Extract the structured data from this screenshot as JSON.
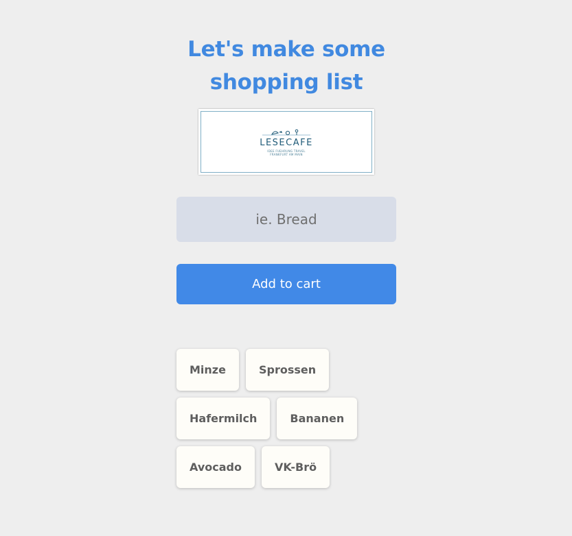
{
  "header": {
    "title_line1": "Let's make some",
    "title_line2": "shopping list"
  },
  "logo": {
    "name": "LESECAFE",
    "subtitle_line1": "IDEE FUEHRUNG TRAVEL",
    "subtitle_line2": "FRANKFURT AM MAIN"
  },
  "form": {
    "input_placeholder": "ie. Bread",
    "input_value": "",
    "add_button_label": "Add to cart"
  },
  "shopping_list": {
    "rows": [
      [
        "Minze",
        "Sprossen"
      ],
      [
        "Hafermilch",
        "Bananen"
      ],
      [
        "Avocado",
        "VK-Brö"
      ]
    ]
  },
  "colors": {
    "accent": "#4189e7",
    "title": "#4189e0",
    "background": "#eeeeee",
    "input_bg": "#d8dde8",
    "chip_bg": "#fefdf8",
    "chip_text": "#5e5e5e"
  }
}
